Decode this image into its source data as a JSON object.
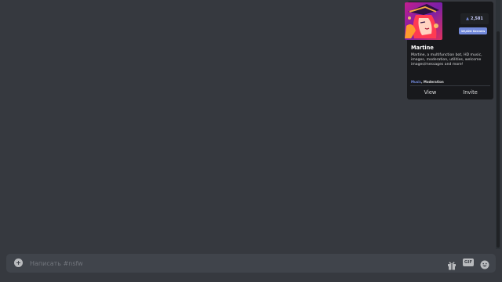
{
  "composer": {
    "placeholder": "Написать #nsfw",
    "gif_label": "GIF"
  },
  "bot_card": {
    "name": "Martine",
    "description": "Martine, a multifunction bot, HD music, images, moderation, utilities, welcome images/messages and more!",
    "votes": "2,581",
    "servers_badge": "16,424 Servers",
    "tags": [
      "Music",
      "Moderation"
    ],
    "tag_separator": ", ",
    "view_label": "View",
    "invite_label": "Invite"
  },
  "colors": {
    "background": "#36393f",
    "card": "#18191c",
    "accent": "#7289da",
    "composer": "#40444b"
  }
}
